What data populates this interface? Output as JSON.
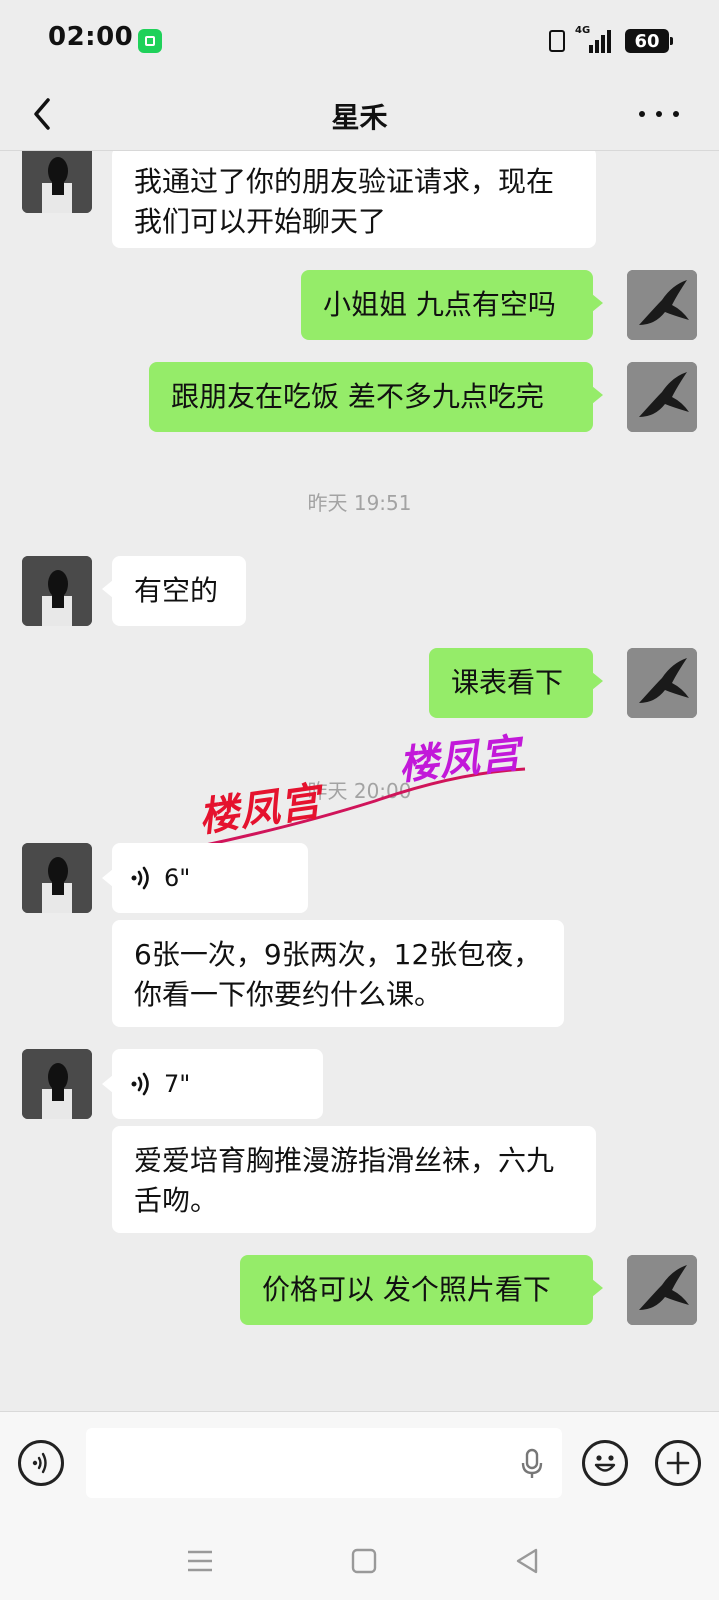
{
  "status": {
    "time": "02:00",
    "network": "4G",
    "battery": "60"
  },
  "header": {
    "title": "星禾"
  },
  "messages": {
    "m1": "我通过了你的朋友验证请求，现在我们可以开始聊天了",
    "m2": "小姐姐 九点有空吗",
    "m3": "跟朋友在吃饭 差不多九点吃完",
    "ts1": "昨天 19:51",
    "m4": "有空的",
    "m5": "课表看下",
    "ts2": "昨天 20:00",
    "v1": "6\"",
    "m6": "6张一次，9张两次，12张包夜，你看一下你要约什么课。",
    "v2": "7\"",
    "m7": "爱爱培育胸推漫游指滑丝袜，六九舌吻。",
    "m8": "价格可以 发个照片看下"
  },
  "watermark": {
    "text1": "楼凤宫",
    "text2": "楼凤宫"
  },
  "icons": {
    "back": "chevron-left-icon",
    "more": "more-dots-icon",
    "voice": "voice-input-icon",
    "mic": "mic-icon",
    "emoji": "emoji-icon",
    "plus": "plus-icon"
  },
  "colors": {
    "outgoing_bubble": "#95ec69",
    "incoming_bubble": "#ffffff",
    "background": "#ededed"
  }
}
